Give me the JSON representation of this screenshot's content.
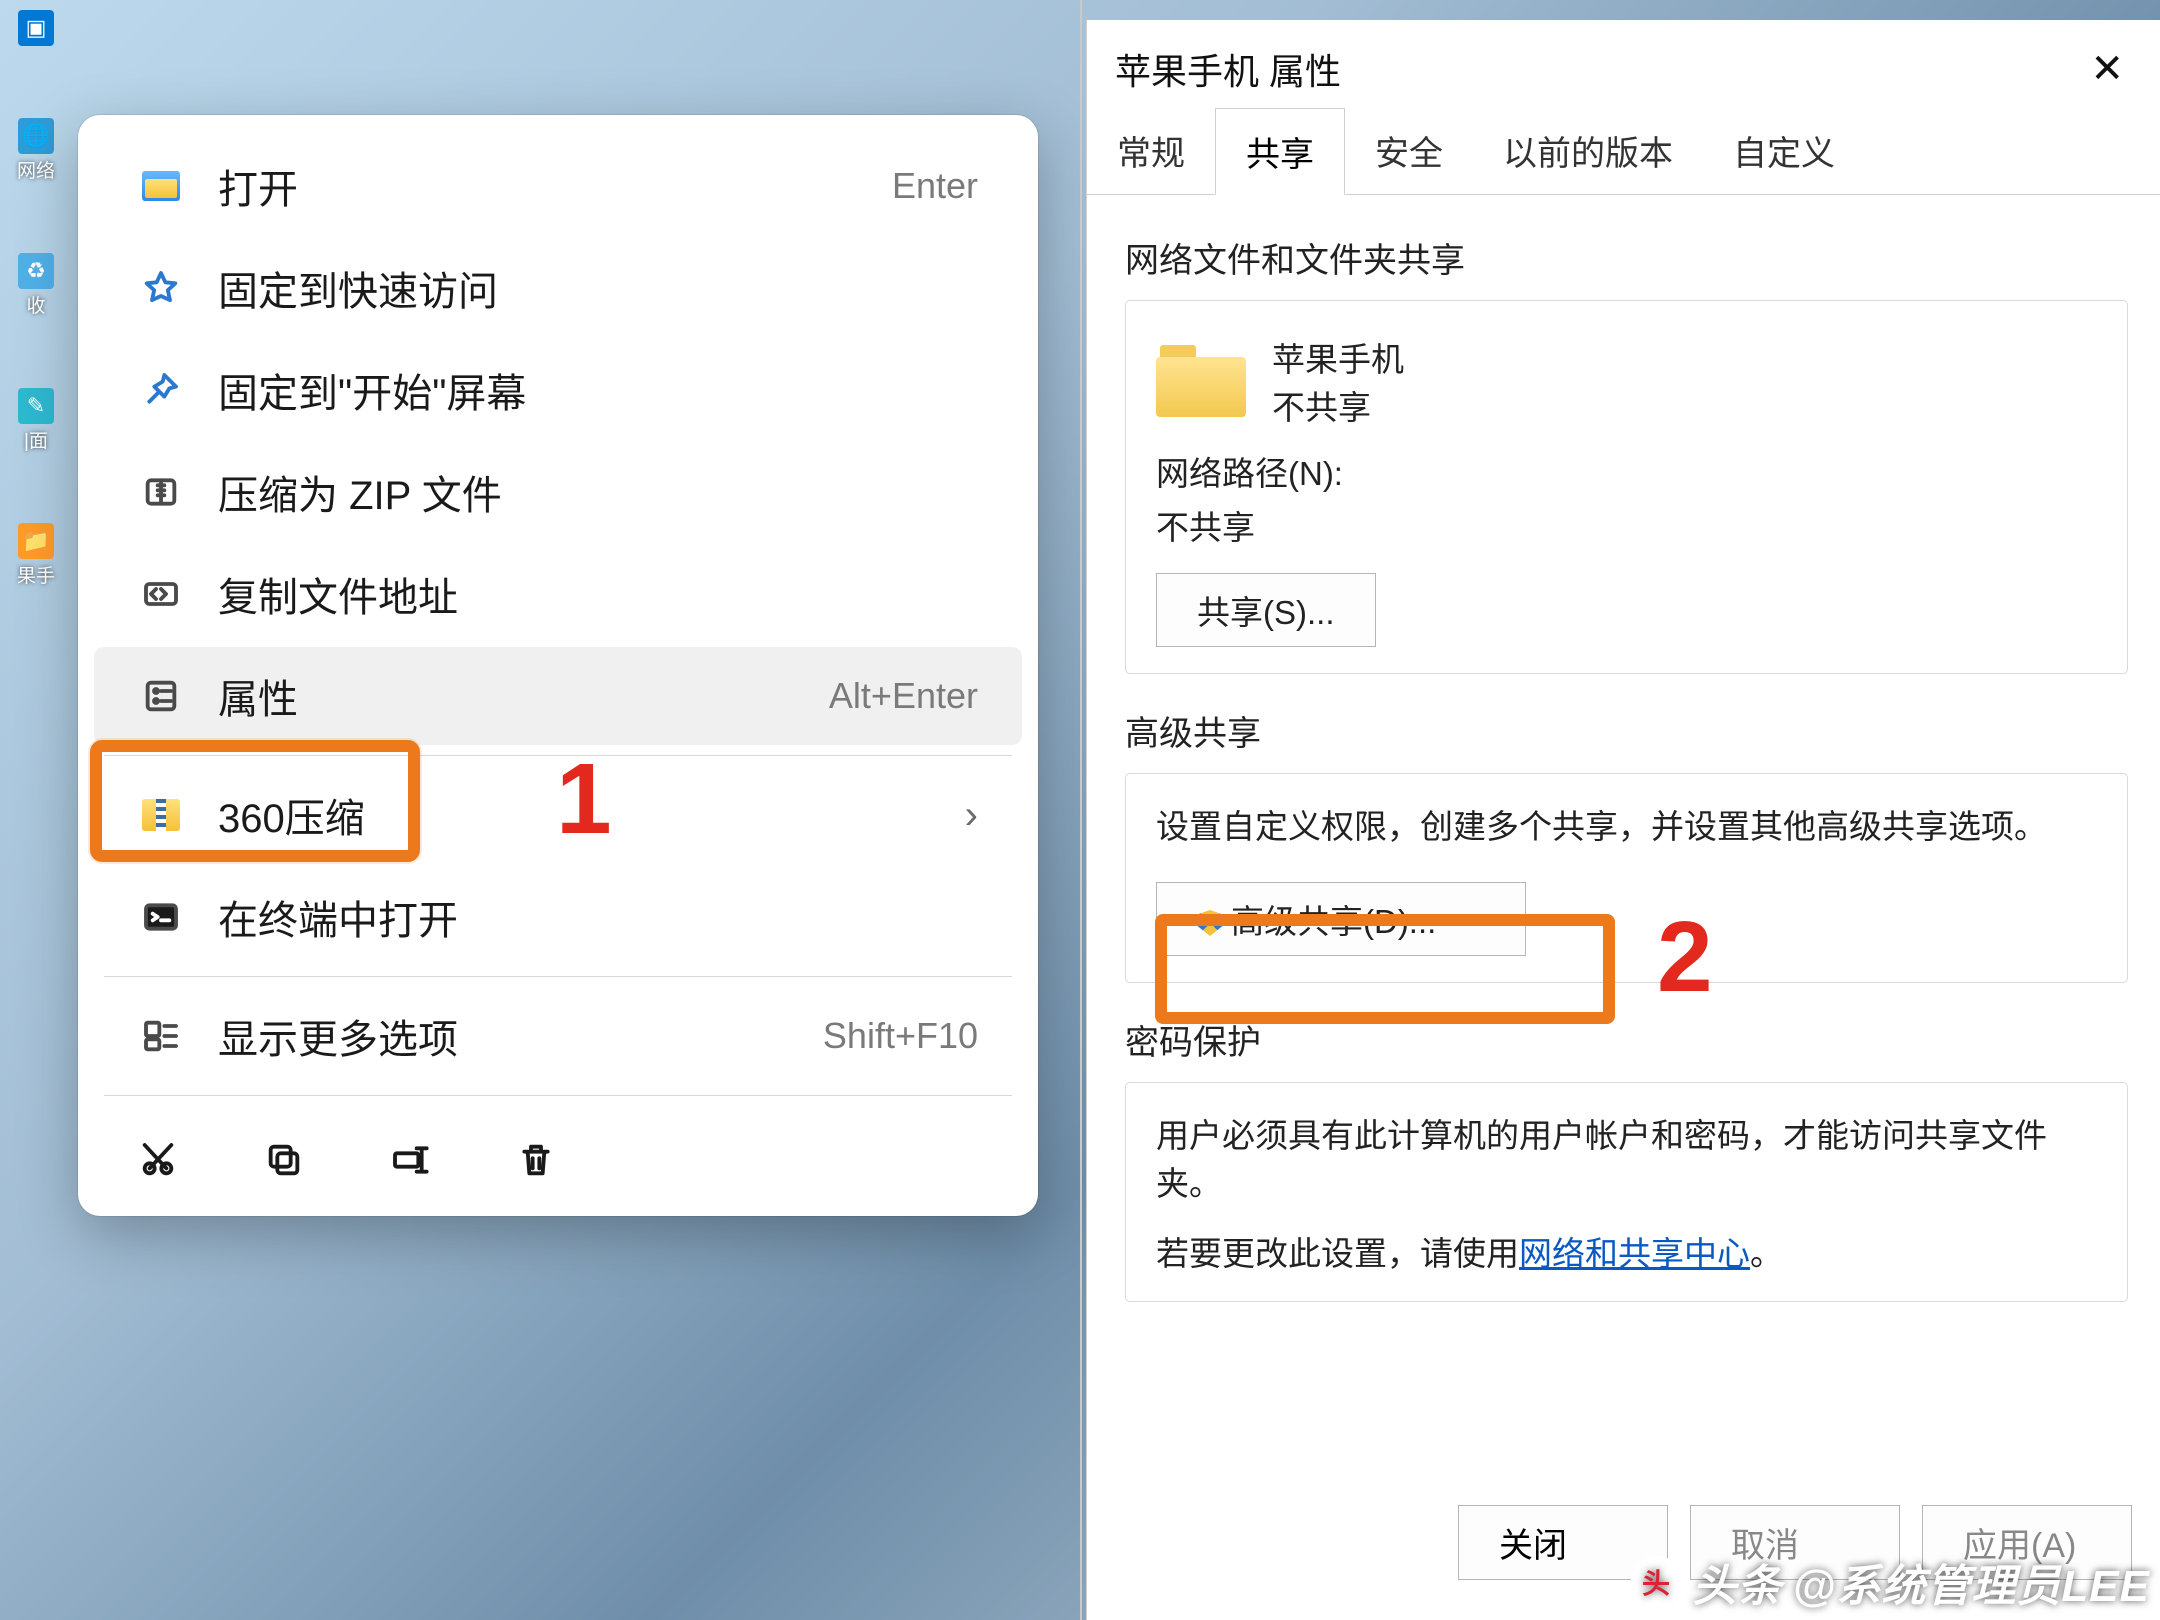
{
  "annotations": {
    "num1": "1",
    "num2": "2"
  },
  "watermark": {
    "prefix": "头条",
    "name": "@系统管理员LEE"
  },
  "desktop": {
    "icons": [
      {
        "label": ""
      },
      {
        "label": "网络"
      },
      {
        "label": ""
      },
      {
        "label": "收"
      },
      {
        "label": ""
      },
      {
        "label": "|面"
      },
      {
        "label": ""
      },
      {
        "label": "果手"
      }
    ]
  },
  "context_menu": {
    "items": [
      {
        "icon": "folder-open",
        "label": "打开",
        "shortcut": "Enter"
      },
      {
        "icon": "star",
        "label": "固定到快速访问"
      },
      {
        "icon": "pin",
        "label": "固定到\"开始\"屏幕"
      },
      {
        "icon": "zip",
        "label": "压缩为 ZIP 文件"
      },
      {
        "icon": "path",
        "label": "复制文件地址"
      },
      {
        "icon": "props",
        "label": "属性",
        "shortcut": "Alt+Enter"
      },
      {
        "sep": true
      },
      {
        "icon": "360zip",
        "label": "360压缩",
        "sub": true
      },
      {
        "icon": "terminal",
        "label": "在终端中打开"
      },
      {
        "sep": true
      },
      {
        "icon": "more",
        "label": "显示更多选项",
        "shortcut": "Shift+F10"
      }
    ],
    "bottom": [
      "cut",
      "copy",
      "rename",
      "delete"
    ]
  },
  "props": {
    "title": "苹果手机 属性",
    "tabs": [
      "常规",
      "共享",
      "安全",
      "以前的版本",
      "自定义"
    ],
    "active_tab": 1,
    "section1": {
      "title": "网络文件和文件夹共享",
      "folder_name": "苹果手机",
      "folder_state": "不共享",
      "netpath_label": "网络路径(N):",
      "netpath_value": "不共享",
      "share_btn": "共享(S)..."
    },
    "section2": {
      "title": "高级共享",
      "desc": "设置自定义权限，创建多个共享，并设置其他高级共享选项。",
      "btn": "高级共享(D)..."
    },
    "section3": {
      "title": "密码保护",
      "line1": "用户必须具有此计算机的用户帐户和密码，才能访问共享文件夹。",
      "line2a": "若要更改此设置，请使用",
      "link": "网络和共享中心",
      "line2b": "。"
    },
    "buttons": {
      "close": "关闭",
      "cancel": "取消",
      "apply": "应用(A)"
    }
  }
}
